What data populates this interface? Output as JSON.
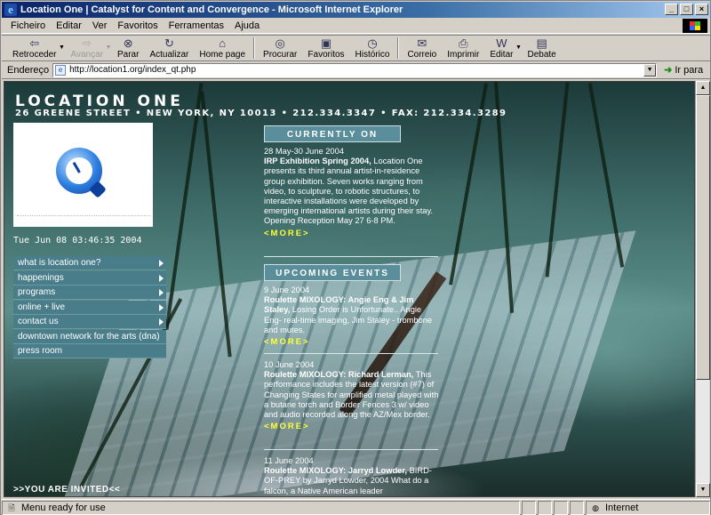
{
  "window": {
    "title": "Location One | Catalyst for Content and Convergence - Microsoft Internet Explorer",
    "controls": [
      "_",
      "□",
      "×"
    ]
  },
  "menu": [
    "Ficheiro",
    "Editar",
    "Ver",
    "Favoritos",
    "Ferramentas",
    "Ajuda"
  ],
  "toolbar": {
    "back": "Retroceder",
    "forward": "Avançar",
    "stop": "Parar",
    "refresh": "Actualizar",
    "home": "Home page",
    "search": "Procurar",
    "favorites": "Favoritos",
    "history": "Histórico",
    "mail": "Correio",
    "print": "Imprimir",
    "edit": "Editar",
    "discuss": "Debate"
  },
  "address": {
    "label": "Endereço",
    "url": "http://location1.org/index_qt.php",
    "go": "Ir para"
  },
  "page": {
    "title": "LOCATION ONE",
    "address_line": "26 GREENE STREET • NEW YORK, NY 10013 • 212.334.3347 • FAX: 212.334.3289",
    "clock": "Tue Jun 08 03:46:35 2004",
    "nav": [
      {
        "label": "what is location one?",
        "arrow": true
      },
      {
        "label": "happenings",
        "arrow": true
      },
      {
        "label": "programs",
        "arrow": true
      },
      {
        "label": "online + live",
        "arrow": true
      },
      {
        "label": "contact us",
        "arrow": true
      },
      {
        "label": "downtown network for the arts (dna)",
        "arrow": false
      },
      {
        "label": "press room",
        "arrow": false
      }
    ],
    "invited": ">>YOU ARE INVITED<<",
    "currently_on": {
      "header": "CURRENTLY ON",
      "date": "28 May-30 June 2004",
      "title": "IRP Exhibition Spring 2004,",
      "body": " Location One presents its third annual artist-in-residence group exhibition. Seven works ranging from video, to sculpture, to robotic structures, to interactive installations were developed by emerging international artists during their stay. Opening Reception May 27 6-8 PM.",
      "more": "<MORE>"
    },
    "upcoming": {
      "header": "UPCOMING EVENTS",
      "events": [
        {
          "date": "9 June 2004",
          "title": "Roulette MIXOLOGY: Angie Eng & Jim Staley,",
          "body": " Losing Order is Unfortunate.. Angie Eng- real-time imaging, Jim Staley - trombone and mutes.",
          "more": "<MORE>"
        },
        {
          "date": "10 June 2004",
          "title": "Roulette MIXOLOGY: Richard Lerman,",
          "body": " This performance includes the latest version (#7) of Changing States for amplified metal played with a butane torch and Border Fences 3 w/ video and audio recorded along the AZ/Mex border.",
          "more": "<MORE>"
        },
        {
          "date": "11 June 2004",
          "title": "Roulette MIXOLOGY: Jarryd Lowder,",
          "body": " BIRD-OF-PREY by Jarryd Lowder, 2004 What do a falcon, a Native American leader",
          "more": ""
        }
      ]
    }
  },
  "status": {
    "text": "Menu ready for use",
    "zone": "Internet"
  }
}
